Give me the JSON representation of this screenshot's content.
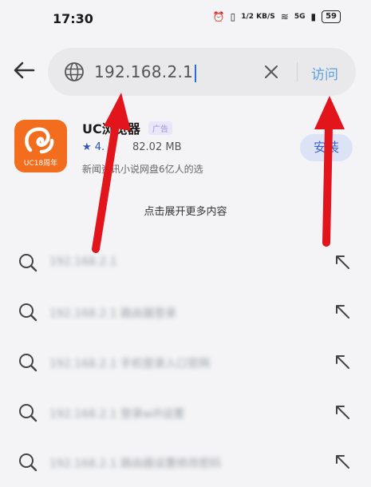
{
  "status": {
    "time": "17:30",
    "network": "1/2 KB/S",
    "signal": "5G",
    "battery": "59"
  },
  "search": {
    "url": "192.168.2.1",
    "visit_label": "访问"
  },
  "app": {
    "name": "UC浏览器",
    "ad_badge": "广告",
    "rating": "★ 4.",
    "size": "82.02 MB",
    "description": "新闻资讯小说网盘6亿人的选",
    "icon_text": "UC18周年",
    "install_label": "安装"
  },
  "expand_label": "点击展开更多内容",
  "suggestions": [
    {
      "text": "192.168.2.1"
    },
    {
      "text": "192.168.2.1 路由器登录"
    },
    {
      "text": "192.168.2.1 手机登录入口官网"
    },
    {
      "text": "192.168.2.1 登录wifi设置"
    },
    {
      "text": "192.168.2.1 路由器设置修改密码"
    }
  ],
  "colors": {
    "accent": "#5b9fe0",
    "arrow": "#e2141c",
    "icon_orange": "#f26d1d"
  }
}
